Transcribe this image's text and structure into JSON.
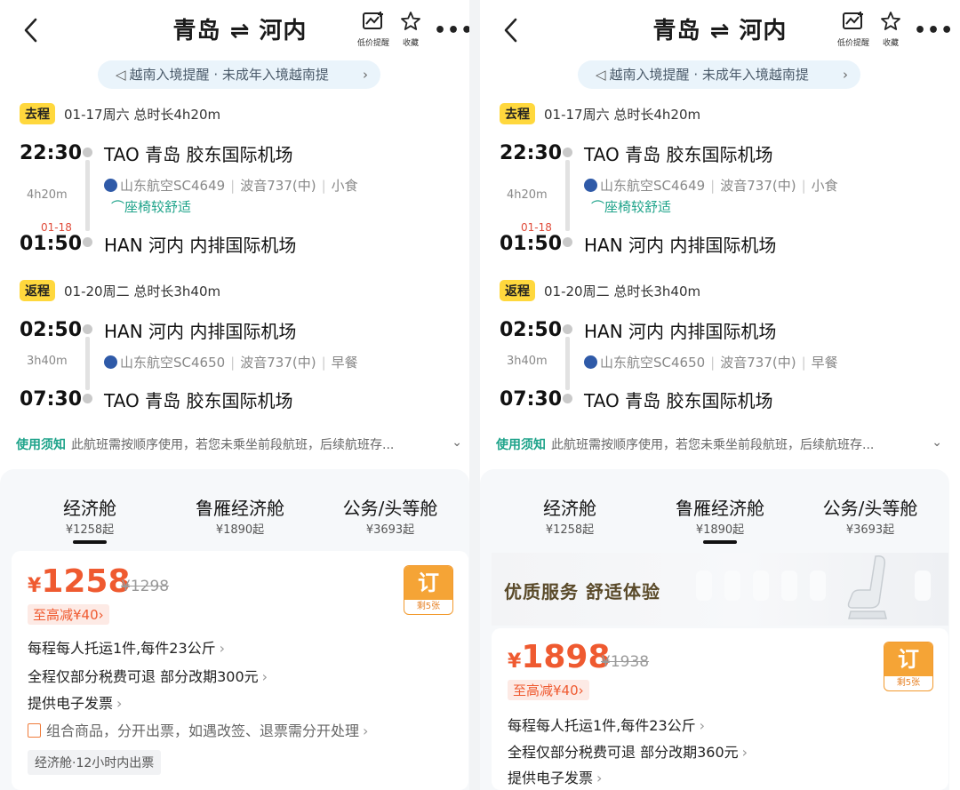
{
  "header": {
    "title": "青岛 ⇌ 河内",
    "price_alert_label": "低价提醒",
    "favorite_label": "收藏",
    "more_label": "•••"
  },
  "notice": {
    "text": "越南入境提醒 · 未成年入境越南提",
    "chevron": "›"
  },
  "outbound": {
    "tag": "去程",
    "info": "01-17周六  总时长4h20m",
    "depart_time": "22:30",
    "depart_airport": "TAO  青岛  胶东国际机场",
    "duration": "4h20m",
    "flight": "山东航空SC4649",
    "aircraft": "波音737(中)",
    "meal": "小食",
    "comfort": "座椅较舒适",
    "arrive_nextday": "01-18",
    "arrive_time": "01:50",
    "arrive_airport": "HAN  河内  内排国际机场"
  },
  "return": {
    "tag": "返程",
    "info": "01-20周二  总时长3h40m",
    "depart_time": "02:50",
    "depart_airport": "HAN  河内  内排国际机场",
    "duration": "3h40m",
    "flight": "山东航空SC4650",
    "aircraft": "波音737(中)",
    "meal": "早餐",
    "arrive_time": "07:30",
    "arrive_airport": "TAO  青岛  胶东国际机场"
  },
  "rules": {
    "label": "使用须知",
    "text": "此航班需按顺序使用，若您未乘坐前段航班，后续航班存..."
  },
  "cabins": [
    {
      "name": "经济舱",
      "price": "¥1258起"
    },
    {
      "name": "鲁雁经济舱",
      "price": "¥1890起"
    },
    {
      "name": "公务/头等舱",
      "price": "¥3693起"
    }
  ],
  "left_card": {
    "currency": "¥",
    "price": "1258",
    "original_price": "¥1298",
    "discount": "至高减¥40",
    "book_label": "订",
    "remaining": "剩5张",
    "baggage": "每程每人托运1件,每件23公斤",
    "refund": "全程仅部分税费可退  部分改期300元",
    "invoice": "提供电子发票",
    "combo_note": "组合商品，分开出票，如遇改签、退票需分开处理",
    "ticketing": "经济舱·12小时内出票"
  },
  "right_promo": {
    "text": "优质服务  舒适体验"
  },
  "right_card": {
    "currency": "¥",
    "price": "1898",
    "original_price": "¥1938",
    "discount": "至高减¥40",
    "book_label": "订",
    "remaining": "剩5张",
    "baggage": "每程每人托运1件,每件23公斤",
    "refund": "全程仅部分税费可退  部分改期360元",
    "invoice": "提供电子发票"
  },
  "colors": {
    "accent_orange": "#ef5a30",
    "tag_yellow": "#ffd83d",
    "teal": "#1ea38a",
    "book_orange": "#f5a436"
  }
}
